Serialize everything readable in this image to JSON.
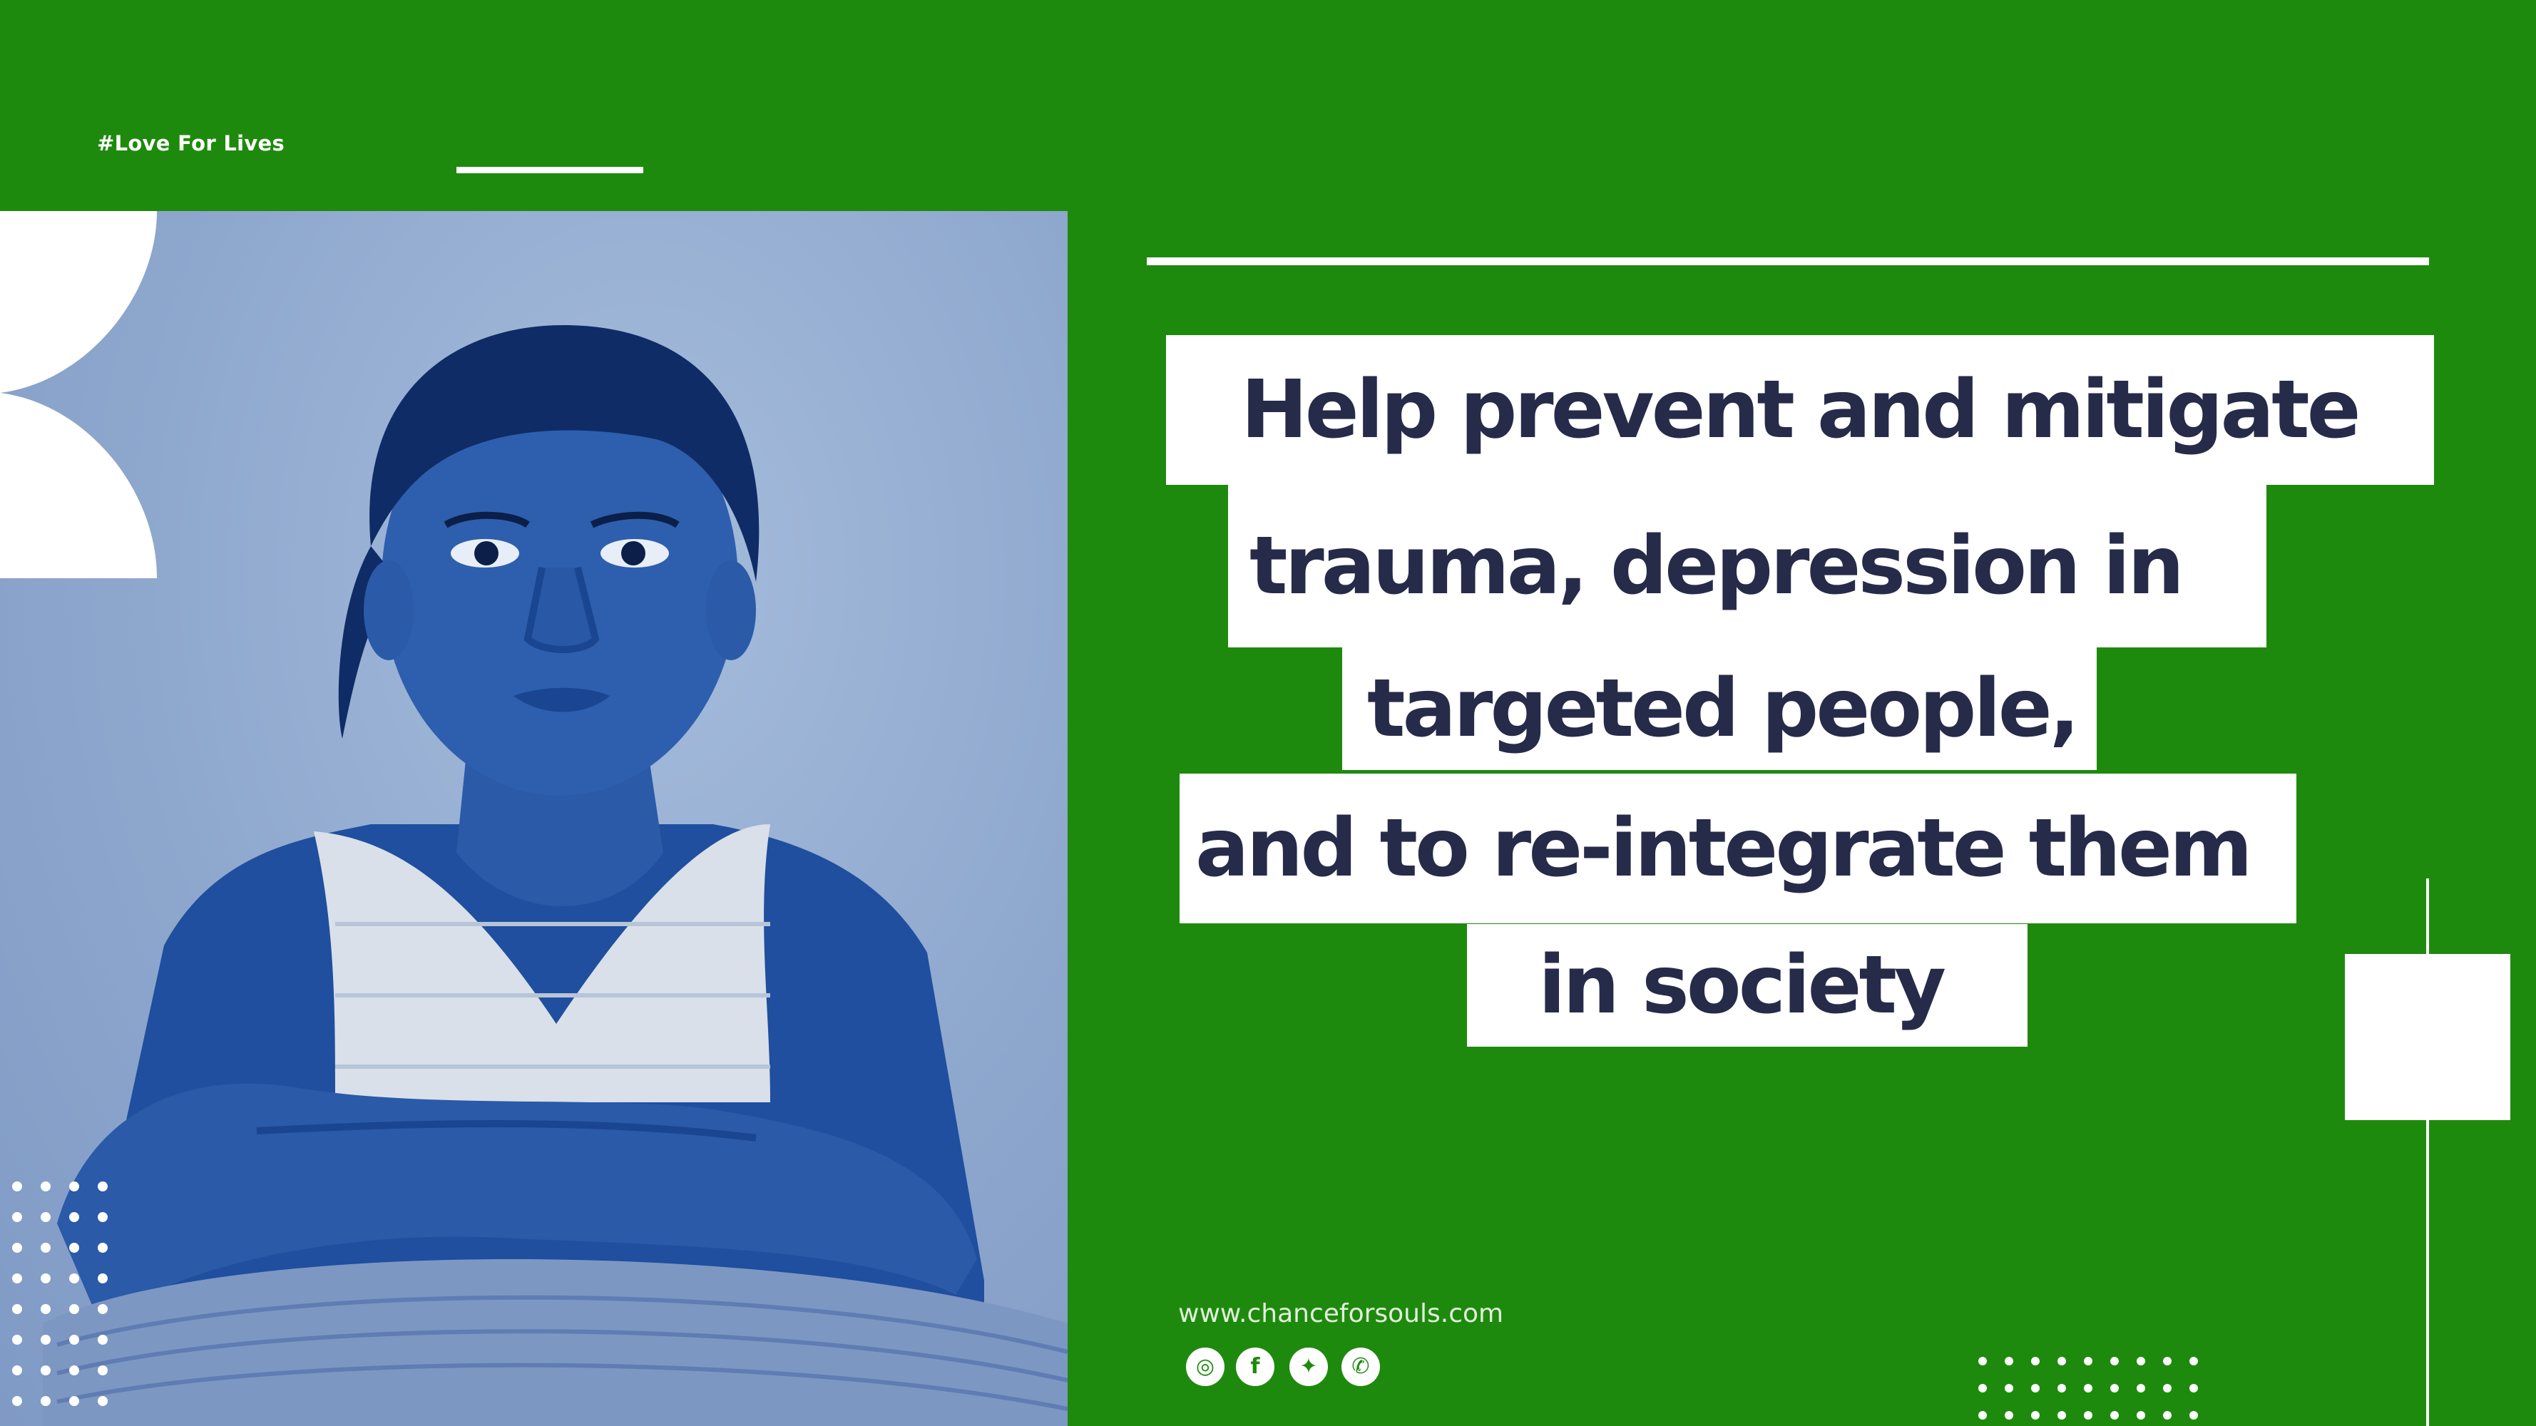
{
  "tagline": "#Love For Lives",
  "headline": {
    "lines": [
      "Help prevent and mitigate",
      "trauma, depression in",
      "targeted people,",
      "and to re-integrate them",
      "in society"
    ]
  },
  "website": "www.chanceforsouls.com",
  "social": [
    {
      "icon": "instagram-icon",
      "glyph": "◎"
    },
    {
      "icon": "facebook-icon",
      "glyph": "f"
    },
    {
      "icon": "twitter-icon",
      "glyph": "✦"
    },
    {
      "icon": "whatsapp-icon",
      "glyph": "✆"
    }
  ],
  "colors": {
    "background": "#1e8a0d",
    "headline_text": "#272b4a",
    "photo_tint": "#2f5aa6",
    "accent": "#ffffff"
  }
}
